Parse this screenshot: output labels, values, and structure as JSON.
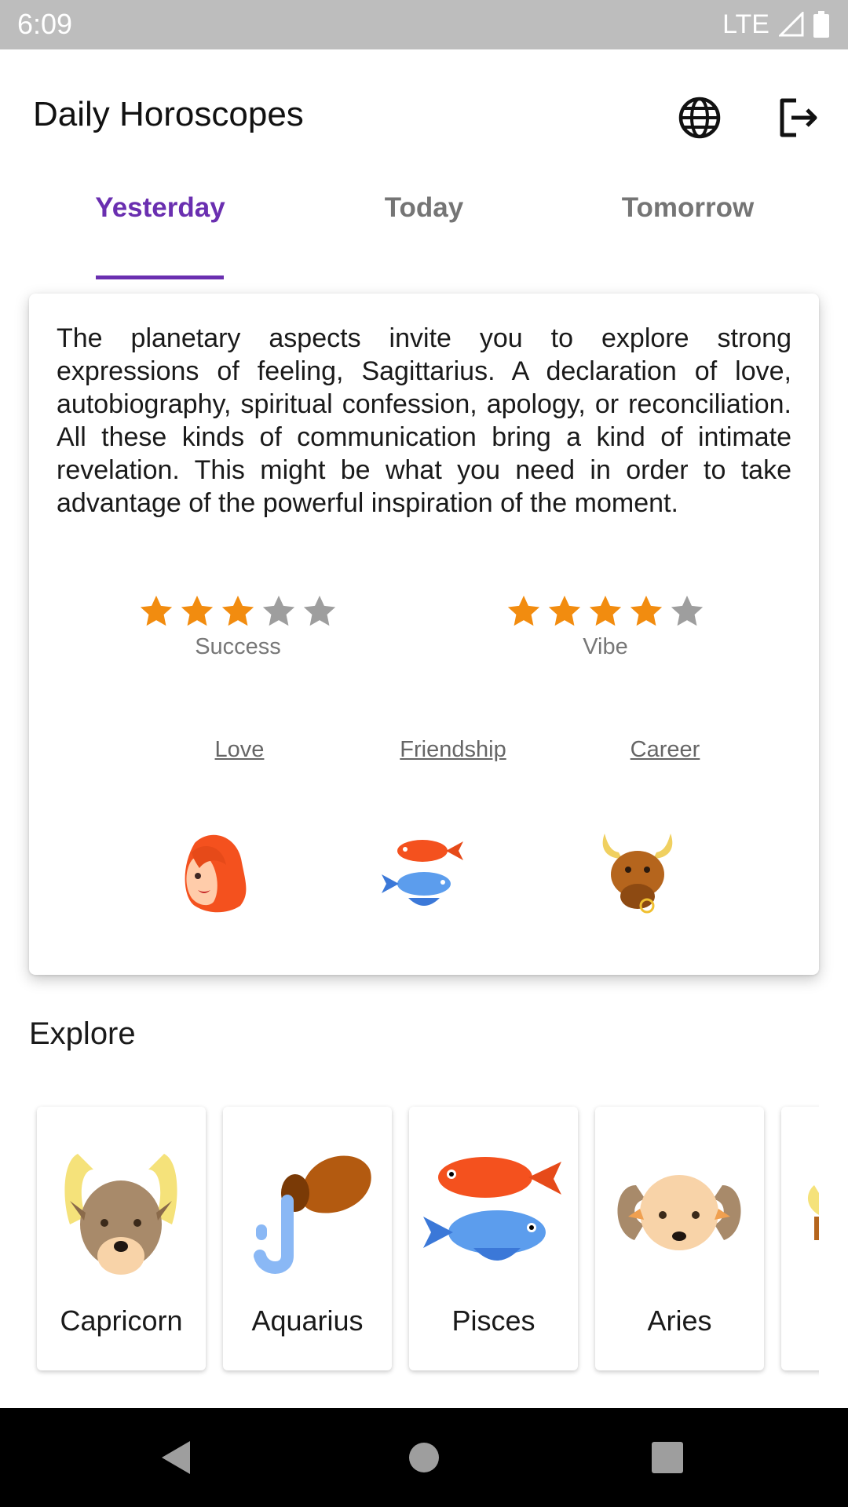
{
  "status_bar": {
    "time": "6:09",
    "network": "LTE"
  },
  "app_bar": {
    "title": "Daily Horoscopes",
    "language_icon": "globe-icon",
    "logout_icon": "logout-icon"
  },
  "tabs": [
    {
      "label": "Yesterday",
      "active": true
    },
    {
      "label": "Today",
      "active": false
    },
    {
      "label": "Tomorrow",
      "active": false
    }
  ],
  "horoscope": {
    "text": "The planetary aspects invite you to explore strong expressions of feeling, Sagittarius. A declaration of love, autobiography, spiritual confession, apology, or reconciliation. All these kinds of communication bring a kind of intimate revelation. This might be what you need in order to take advantage of the powerful inspiration of the moment.",
    "ratings": [
      {
        "label": "Success",
        "stars": 3,
        "max": 5
      },
      {
        "label": "Vibe",
        "stars": 4,
        "max": 5
      }
    ],
    "compatibility": [
      {
        "label": "Love",
        "icon": "woman-icon"
      },
      {
        "label": "Friendship",
        "icon": "pisces-fish-icon"
      },
      {
        "label": "Career",
        "icon": "bull-icon"
      }
    ]
  },
  "explore": {
    "title": "Explore",
    "signs": [
      {
        "name": "Capricorn",
        "icon": "capricorn-icon"
      },
      {
        "name": "Aquarius",
        "icon": "aquarius-icon"
      },
      {
        "name": "Pisces",
        "icon": "pisces-icon"
      },
      {
        "name": "Aries",
        "icon": "aries-icon"
      }
    ]
  },
  "colors": {
    "accent": "#6a2fb0",
    "star_filled": "#f28c0f",
    "star_empty": "#9e9e9e"
  },
  "nav_bar": {
    "back_icon": "back-icon",
    "home_icon": "home-icon",
    "recents_icon": "recents-icon"
  }
}
